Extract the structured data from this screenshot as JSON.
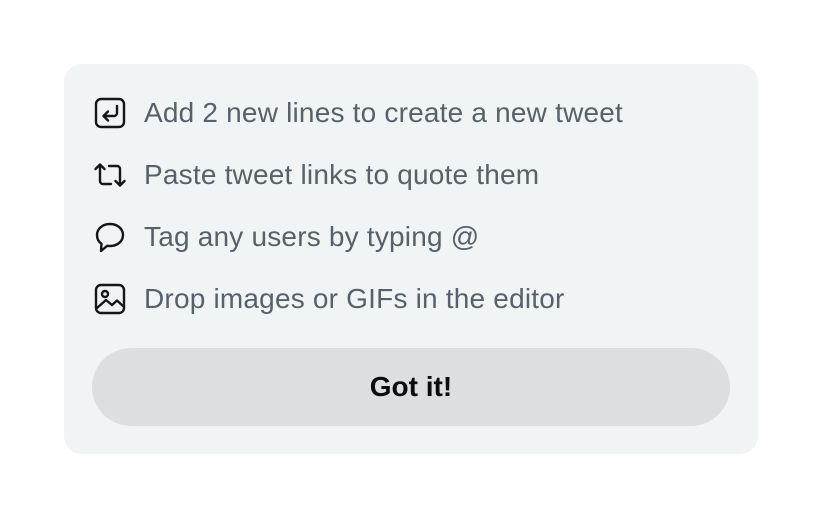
{
  "tips": [
    {
      "icon": "enter-return-icon",
      "label": "Add 2 new lines to create a new tweet"
    },
    {
      "icon": "retweet-icon",
      "label": "Paste tweet links to quote them"
    },
    {
      "icon": "speech-bubble-icon",
      "label": "Tag any users by typing @"
    },
    {
      "icon": "image-icon",
      "label": "Drop images or GIFs in the editor"
    }
  ],
  "button": {
    "label": "Got it!"
  },
  "colors": {
    "card_background": "#f1f4f5",
    "text": "#56616b",
    "button_background": "#dcdfe0",
    "button_text": "#0b0c0d"
  }
}
